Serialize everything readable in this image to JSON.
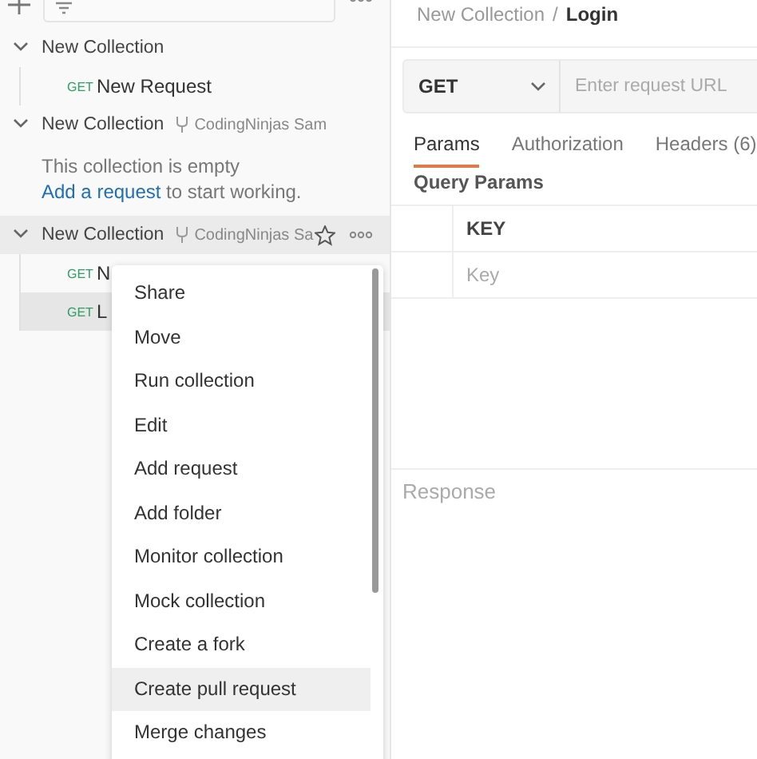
{
  "sidebar": {
    "collections": [
      {
        "name": "New Collection",
        "expanded": true,
        "selected": false,
        "requests": [
          {
            "method": "GET",
            "name": "New Request",
            "selected": false
          }
        ]
      },
      {
        "name": "New Collection",
        "fork": "CodingNinjas Sam",
        "expanded": true,
        "selected": false,
        "empty_text": "This collection is empty",
        "empty_link": "Add a request",
        "empty_suffix": " to start working."
      },
      {
        "name": "New Collection",
        "fork": "CodingNinjas Sa",
        "expanded": true,
        "selected": true,
        "requests": [
          {
            "method": "GET",
            "name": "N",
            "selected": false
          },
          {
            "method": "GET",
            "name": "L",
            "selected": true
          }
        ]
      }
    ]
  },
  "context_menu": {
    "items": [
      {
        "label": "Share",
        "selected": false
      },
      {
        "label": "Move",
        "selected": false
      },
      {
        "label": "Run collection",
        "selected": false
      },
      {
        "label": "Edit",
        "selected": false
      },
      {
        "label": "Add request",
        "selected": false
      },
      {
        "label": "Add folder",
        "selected": false
      },
      {
        "label": "Monitor collection",
        "selected": false
      },
      {
        "label": "Mock collection",
        "selected": false
      },
      {
        "label": "Create a fork",
        "selected": false
      },
      {
        "label": "Create pull request",
        "selected": true
      },
      {
        "label": "Merge changes",
        "selected": false
      }
    ]
  },
  "request": {
    "breadcrumb": {
      "parent": "New Collection",
      "separator": "/",
      "current": "Login"
    },
    "method": "GET",
    "url": {
      "placeholder": "Enter request URL"
    },
    "tabs": [
      {
        "label": "Params",
        "selected": true
      },
      {
        "label": "Authorization",
        "selected": false
      },
      {
        "label": "Headers (6)",
        "selected": false
      }
    ],
    "section_title": "Query Params",
    "table": {
      "columns": [
        "KEY"
      ],
      "rows": [
        {
          "placeholder": "Key"
        }
      ]
    },
    "response_label": "Response"
  }
}
